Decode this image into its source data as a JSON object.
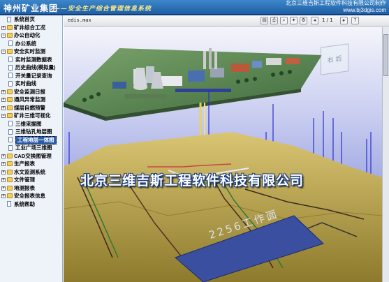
{
  "header": {
    "brand": "神州矿业集团",
    "subtitle": "——安全生产综合管理信息系统",
    "company_line1": "北京三维吉斯工程软件科技有限公司制作",
    "company_line2": "www.bj3dgis.com"
  },
  "sidebar": {
    "items": [
      {
        "label": "系统首页",
        "level": 0,
        "icon": "doc-icon",
        "toggle": ""
      },
      {
        "label": "矿井综合工况",
        "level": 0,
        "icon": "folder-icon",
        "toggle": "+"
      },
      {
        "label": "办公自动化",
        "level": 0,
        "icon": "folder-icon",
        "toggle": "−"
      },
      {
        "label": "办公系统",
        "level": 1,
        "icon": "doc-icon",
        "toggle": ""
      },
      {
        "label": "安全实时监测",
        "level": 0,
        "icon": "folder-icon",
        "toggle": "−"
      },
      {
        "label": "实时监测数据表",
        "level": 1,
        "icon": "doc-icon",
        "toggle": ""
      },
      {
        "label": "历史曲线(模拟量)",
        "level": 1,
        "icon": "doc-icon",
        "toggle": ""
      },
      {
        "label": "开关量记录查询",
        "level": 1,
        "icon": "doc-icon",
        "toggle": ""
      },
      {
        "label": "实时曲线",
        "level": 1,
        "icon": "doc-icon",
        "toggle": ""
      },
      {
        "label": "安全监测日报",
        "level": 0,
        "icon": "folder-icon",
        "toggle": "+"
      },
      {
        "label": "通风异常监测",
        "level": 0,
        "icon": "folder-icon",
        "toggle": "+"
      },
      {
        "label": "煤层自燃预警",
        "level": 0,
        "icon": "folder-icon",
        "toggle": "+"
      },
      {
        "label": "矿井三维可视化",
        "level": 0,
        "icon": "folder-icon",
        "toggle": "−"
      },
      {
        "label": "三维采掘图",
        "level": 1,
        "icon": "doc-icon",
        "toggle": ""
      },
      {
        "label": "三维钻孔地层图",
        "level": 1,
        "icon": "doc-icon",
        "toggle": ""
      },
      {
        "label": "工程地层一体图",
        "level": 1,
        "icon": "doc-icon",
        "toggle": "",
        "selected": true
      },
      {
        "label": "工业广场三维图",
        "level": 1,
        "icon": "doc-icon",
        "toggle": ""
      },
      {
        "label": "CAD交换图管理",
        "level": 0,
        "icon": "folder-icon",
        "toggle": "+"
      },
      {
        "label": "生产报表",
        "level": 0,
        "icon": "folder-icon",
        "toggle": "+"
      },
      {
        "label": "水文监测系统",
        "level": 0,
        "icon": "folder-icon",
        "toggle": "+"
      },
      {
        "label": "文件管理",
        "level": 0,
        "icon": "folder-icon",
        "toggle": "+"
      },
      {
        "label": "地测报表",
        "level": 0,
        "icon": "folder-icon",
        "toggle": "+"
      },
      {
        "label": "安全报表信息",
        "level": 0,
        "icon": "folder-icon",
        "toggle": "+"
      },
      {
        "label": "系统帮助",
        "level": 0,
        "icon": "doc-icon",
        "toggle": ""
      }
    ]
  },
  "viewer": {
    "filename": "edis.max",
    "page_indicator": "1 / 1",
    "cube_label": "右 后",
    "watermark": "北京三维吉斯工程软件科技有限公司",
    "workface_label": "2256工作面"
  },
  "colors": {
    "header_bg": "#2a6db5",
    "sky": "#7e8ad9",
    "ground": "#c9b25a",
    "selection": "#2a5da8"
  }
}
